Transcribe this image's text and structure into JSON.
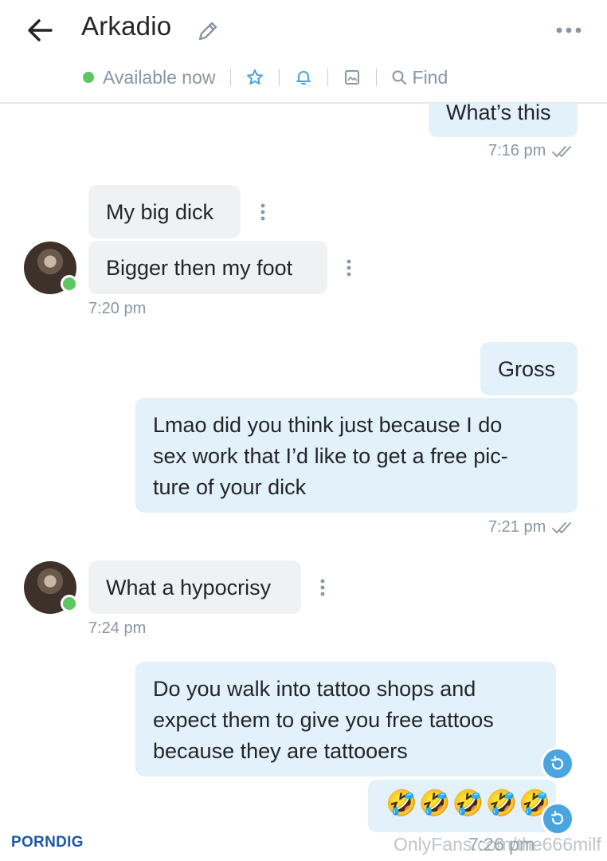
{
  "header": {
    "title": "Arkadio",
    "status": "Available now",
    "find_label": "Find"
  },
  "messages": [
    {
      "text": "What’s this",
      "time": "7:16 pm"
    },
    {
      "text": "My big dick"
    },
    {
      "text": "Bigger then my foot",
      "time": "7:20 pm"
    },
    {
      "text": "Gross"
    },
    {
      "lines": [
        "Lmao did you think just because I do",
        "sex work that I’d like to get a free pic-",
        "ture of your dick"
      ],
      "time": "7:21 pm"
    },
    {
      "text": "What a hypocrisy",
      "time": "7:24 pm"
    },
    {
      "lines": [
        "Do you walk into tattoo shops and",
        "expect them to give you free tattoos",
        "because they are tattooers"
      ]
    },
    {
      "emojis": "🤣🤣🤣🤣🤣",
      "time": "7:26 pm"
    }
  ],
  "watermark": {
    "logo": "PORNDIG",
    "text": "OnlyFans.com/the666milf"
  },
  "colors": {
    "accent": "#4aa4e0",
    "online": "#5cc660",
    "incoming_bubble": "#f0f1f3",
    "outgoing_bubble": "#e2f1fa"
  },
  "icons": [
    "back-arrow-icon",
    "pencil-icon",
    "more-horizontal-icon",
    "star-icon",
    "bell-icon",
    "image-icon",
    "search-icon",
    "kebab-icon",
    "double-check-icon",
    "undo-icon"
  ]
}
